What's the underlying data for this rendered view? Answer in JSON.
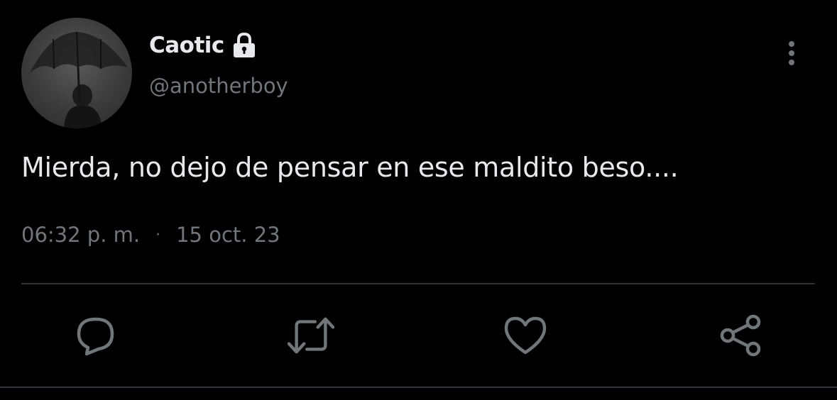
{
  "tweet": {
    "display_name": "Caotic",
    "handle": "@anotherboy",
    "text": "Mierda, no dejo de pensar en ese maldito beso....",
    "time": "06:32 p. m.",
    "separator": "·",
    "date": "15 oct. 23",
    "protected": true
  },
  "actions": [
    {
      "name": "reply",
      "icon": "reply-icon"
    },
    {
      "name": "retweet",
      "icon": "retweet-icon"
    },
    {
      "name": "like",
      "icon": "heart-icon"
    },
    {
      "name": "share",
      "icon": "share-icon"
    }
  ],
  "colors": {
    "background": "#000000",
    "primary_text": "#e7e9ea",
    "secondary_text": "#71767b",
    "divider": "#2f3336"
  }
}
